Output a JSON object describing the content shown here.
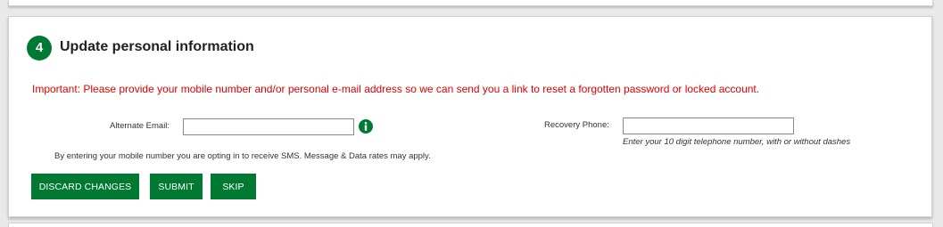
{
  "section": {
    "step_number": "4",
    "title": "Update personal information",
    "important_message": "Important: Please provide your mobile number and/or personal e-mail address so we can send you a link to reset a forgotten password or locked account."
  },
  "form": {
    "email": {
      "label": "Alternate Email:",
      "value": "",
      "info_icon": "info-icon"
    },
    "phone": {
      "label": "Recovery Phone:",
      "value": "",
      "hint": "Enter your 10 digit telephone number, with or without dashes"
    },
    "sms_note": "By entering your mobile number you are opting in to receive SMS. Message & Data rates may apply."
  },
  "buttons": {
    "discard_label": "DISCARD CHANGES",
    "submit_label": "SUBMIT",
    "skip_label": "SKIP"
  },
  "colors": {
    "accent": "#007a33",
    "important_text": "#e00000"
  }
}
